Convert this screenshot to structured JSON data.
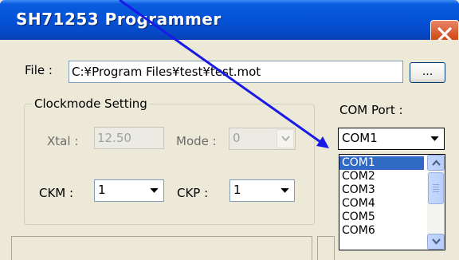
{
  "window": {
    "title": "SH71253 Programmer",
    "close_icon": "close-icon"
  },
  "file": {
    "label": "File :",
    "path": "C:¥Program Files¥test¥test.mot",
    "browse_label": "..."
  },
  "clockmode": {
    "group_title": "Clockmode Setting",
    "xtal_label": "Xtal :",
    "xtal_value": "12.50",
    "mode_label": "Mode :",
    "mode_value": "0",
    "ckm_label": "CKM :",
    "ckm_value": "1",
    "ckp_label": "CKP :",
    "ckp_value": "1"
  },
  "com": {
    "label": "COM Port :",
    "selected": "COM1",
    "options": [
      "COM1",
      "COM2",
      "COM3",
      "COM4",
      "COM5",
      "COM6"
    ]
  },
  "colors": {
    "title_bar": "#0552d6",
    "selection": "#316ac5",
    "annotation_arrow": "#1a1ae6"
  }
}
